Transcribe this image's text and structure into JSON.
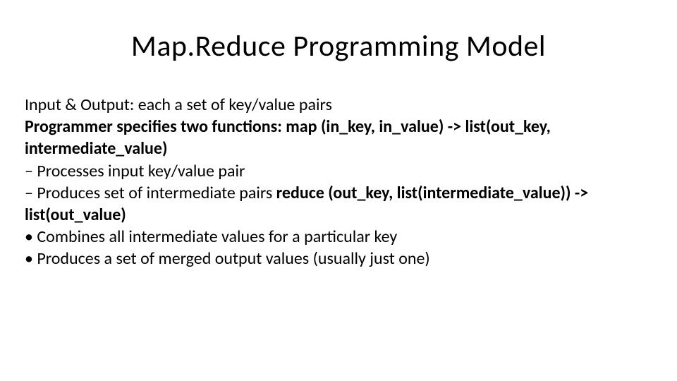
{
  "title": "Map.Reduce Programming Model",
  "lines": {
    "l1_plain": "Input & Output: each a set of key/value pairs",
    "l2_bold": "Programmer specifies two functions: map (in_key, in_value) -> list(out_key, intermediate_value)",
    "l3_plain": "– Processes input key/value pair",
    "l4_prefix": "– Produces set of intermediate pairs ",
    "l4_bold": "reduce (out_key, list(intermediate_value)) -> list(out_value)",
    "l5_plain": "• Combines all intermediate values for a particular key",
    "l6_plain": "• Produces a set of merged output values (usually just one)"
  }
}
